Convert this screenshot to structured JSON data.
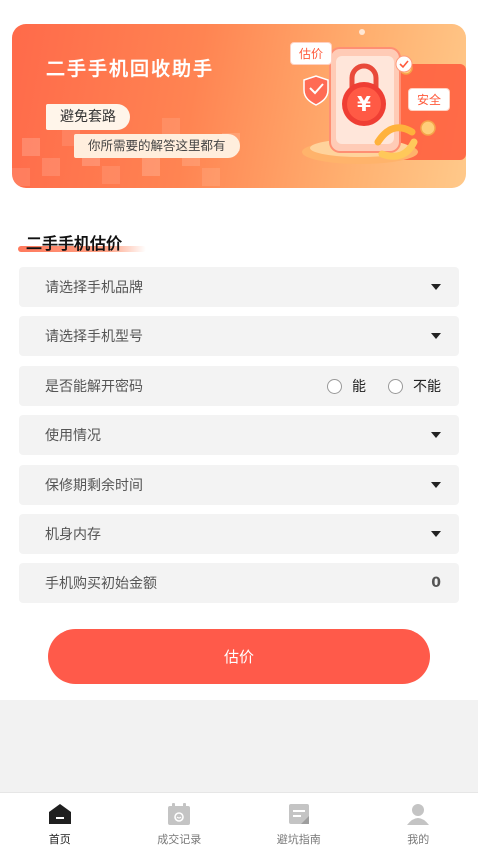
{
  "banner": {
    "title": "二手手机回收助手",
    "tagline": "避免套路",
    "subtitle": "你所需要的解答这里都有",
    "tag_estimate": "估价",
    "tag_safe": "安全",
    "coin_symbol": "¥"
  },
  "form": {
    "section_title": "二手手机估价",
    "brand": {
      "placeholder": "请选择手机品牌"
    },
    "model": {
      "placeholder": "请选择手机型号"
    },
    "unlock": {
      "label": "是否能解开密码",
      "options": [
        "能",
        "不能"
      ]
    },
    "usage": {
      "placeholder": "使用情况"
    },
    "warranty": {
      "placeholder": "保修期剩余时间"
    },
    "storage": {
      "placeholder": "机身内存"
    },
    "price": {
      "label": "手机购买初始金额",
      "value": "0"
    },
    "submit_label": "估价"
  },
  "tabbar": {
    "items": [
      {
        "label": "首页",
        "icon": "home-icon",
        "active": true
      },
      {
        "label": "成交记录",
        "icon": "calendar-icon",
        "active": false
      },
      {
        "label": "避坑指南",
        "icon": "guide-icon",
        "active": false
      },
      {
        "label": "我的",
        "icon": "user-icon",
        "active": false
      }
    ]
  },
  "colors": {
    "accent": "#ff5a4a",
    "active_tab": "#222222",
    "inactive_tab": "#bdbdbd"
  }
}
